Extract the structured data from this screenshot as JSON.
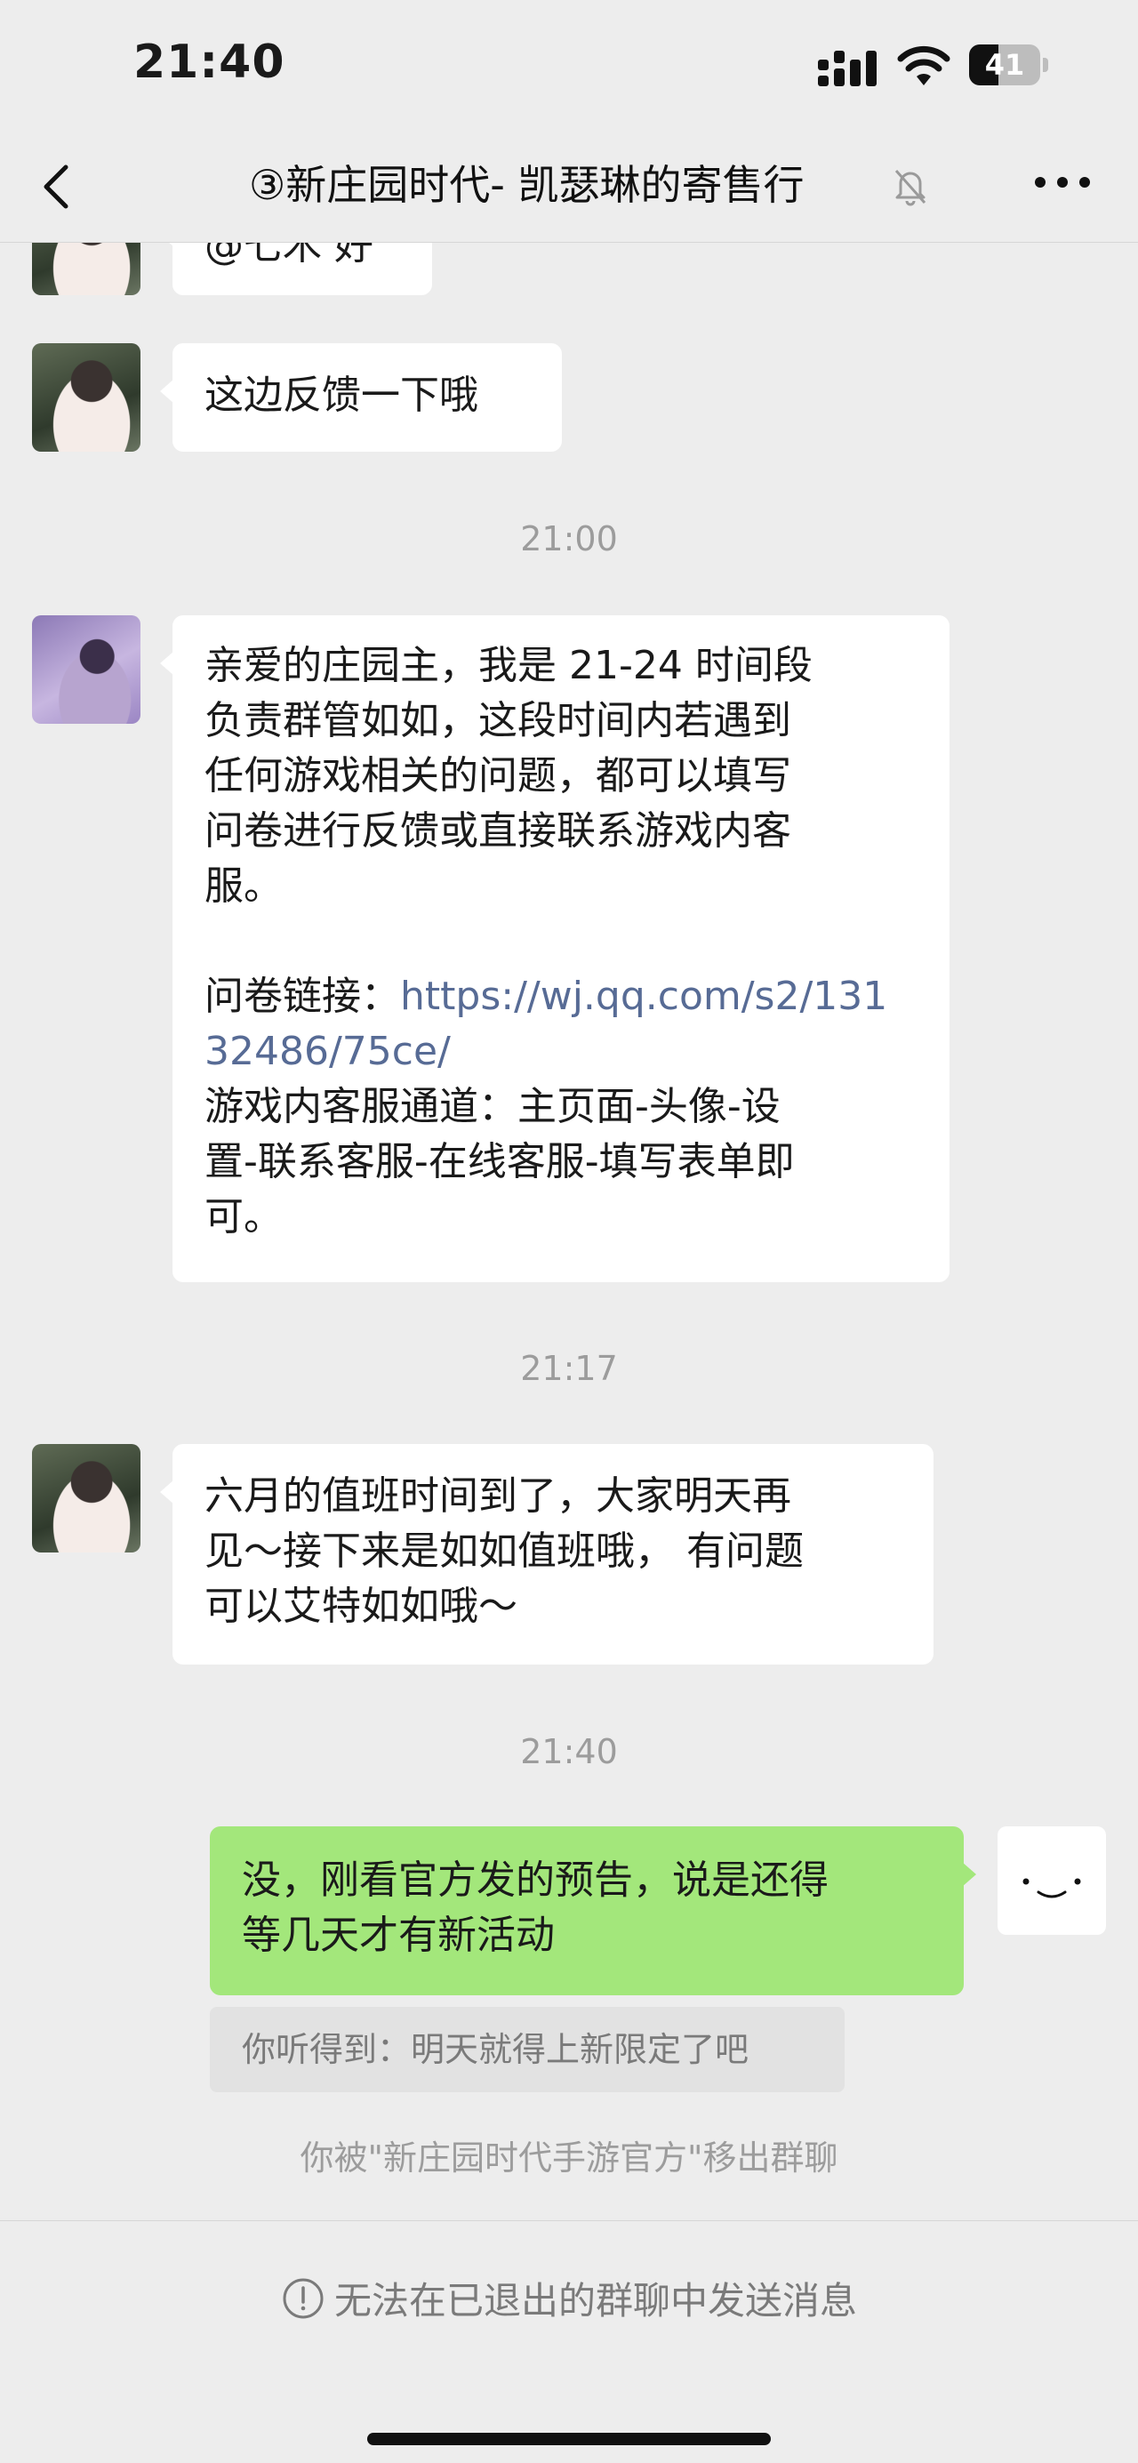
{
  "status_bar": {
    "time": "21:40",
    "battery_level": "41",
    "battery_fraction": 0.41
  },
  "nav": {
    "title": "③新庄园时代- 凯瑟琳的寄售行"
  },
  "messages": {
    "partial_text": "@七木 好",
    "msg1": "这边反馈一下哦",
    "time1": "21:00",
    "msg2_lines": [
      "亲爱的庄园主，我是 21-24 时间段",
      "负责群管如如，这段时间内若遇到",
      "任何游戏相关的问题，都可以填写",
      "问卷进行反馈或直接联系游戏内客",
      "服。"
    ],
    "msg2_link_label": "问卷链接：",
    "msg2_link_line1": "https://wj.qq.com/s2/131",
    "msg2_link_line2": "32486/75ce/",
    "msg2_tail_lines": [
      "游戏内客服通道：主页面-头像-设",
      "置-联系客服-在线客服-填写表单即",
      "可。"
    ],
    "time2": "21:17",
    "msg3_lines": [
      "六月的值班时间到了，大家明天再",
      "见～接下来是如如值班哦， 有问题",
      "可以艾特如如哦～"
    ],
    "time3": "21:40",
    "my_msg_lines": [
      "没，刚看官方发的预告，说是还得",
      "等几天才有新活动"
    ],
    "quote": "你听得到：明天就得上新限定了吧",
    "system_notice": "你被\"新庄园时代手游官方\"移出群聊"
  },
  "footer": {
    "notice": "无法在已退出的群聊中发送消息"
  },
  "colors": {
    "background": "#ededed",
    "my_bubble": "#a3e77b",
    "link": "#576b95"
  },
  "icons": [
    "back-chevron-icon",
    "mute-bell-icon",
    "more-dots-icon",
    "signal-icon",
    "wifi-icon",
    "battery-icon",
    "warning-circle-icon"
  ]
}
